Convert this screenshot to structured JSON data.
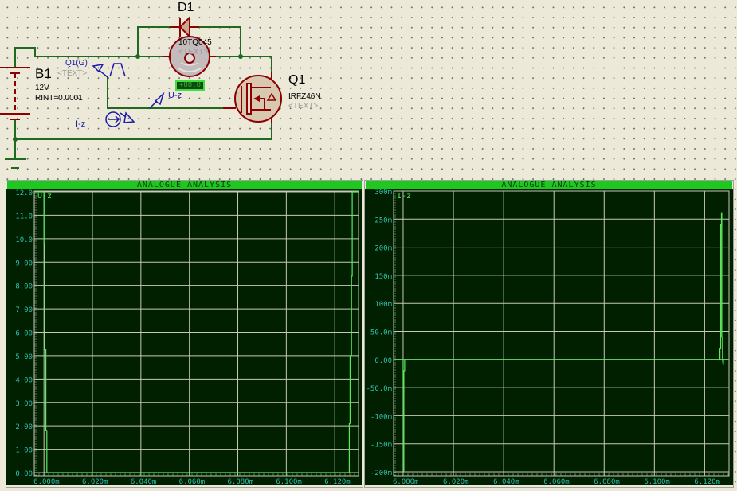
{
  "schematic": {
    "battery": {
      "ref": "B1",
      "text": "<TEXT>",
      "value": "12V",
      "rint": "RINT=0.0001"
    },
    "diode": {
      "ref": "D1",
      "part": "10TQ045"
    },
    "motor": {
      "text": "<TEXT>",
      "display": "+88.8"
    },
    "mosfet": {
      "ref": "Q1",
      "part": "IRFZ46N",
      "text": "<TEXT>"
    },
    "generator": {
      "label": "Q1(G)",
      "text": "<TEXT>"
    },
    "voltage_probe": {
      "label": "U-z"
    },
    "current_probe": {
      "label": "I-z"
    },
    "colors": {
      "wire": "#1f6a1f",
      "component": "#8b0000",
      "probe": "#1a1aa8"
    }
  },
  "chart_data": [
    {
      "type": "line",
      "title": "ANALOGUE ANALYSIS",
      "xlabel": "",
      "ylabel": "",
      "grid": true,
      "xlim": [
        5.996,
        6.1298
      ],
      "ylim": [
        0,
        12
      ],
      "xticks": [
        "6.000m",
        "6.020m",
        "6.040m",
        "6.060m",
        "6.080m",
        "6.100m",
        "6.120m"
      ],
      "xtick_values": [
        6.0,
        6.02,
        6.04,
        6.06,
        6.08,
        6.1,
        6.12
      ],
      "yticks": [
        "0.00",
        "1.00",
        "2.00",
        "3.00",
        "4.00",
        "5.00",
        "6.00",
        "7.00",
        "8.00",
        "9.00",
        "10.0",
        "11.0",
        "12.0"
      ],
      "ytick_values": [
        0,
        1,
        2,
        3,
        4,
        5,
        6,
        7,
        8,
        9,
        10,
        11,
        12
      ],
      "series": [
        {
          "name": "U-z",
          "color": "#5ee65e",
          "points": [
            [
              5.996,
              12
            ],
            [
              6.0,
              12
            ],
            [
              6.0,
              9.8
            ],
            [
              6.0003,
              9.8
            ],
            [
              6.0003,
              5.25
            ],
            [
              6.0008,
              5.25
            ],
            [
              6.0008,
              1.8
            ],
            [
              6.0012,
              1.8
            ],
            [
              6.0012,
              0
            ],
            [
              6.126,
              0
            ],
            [
              6.126,
              2.1
            ],
            [
              6.1263,
              2.1
            ],
            [
              6.1263,
              5.0
            ],
            [
              6.1269,
              5.0
            ],
            [
              6.1269,
              8.4
            ],
            [
              6.1272,
              8.4
            ],
            [
              6.1272,
              12
            ],
            [
              6.1298,
              12
            ]
          ]
        }
      ]
    },
    {
      "type": "line",
      "title": "ANALOGUE ANALYSIS",
      "xlabel": "",
      "ylabel": "",
      "grid": true,
      "xlim": [
        5.9962,
        6.1297
      ],
      "ylim": [
        -200,
        300
      ],
      "xticks": [
        "6.000m",
        "6.020m",
        "6.040m",
        "6.060m",
        "6.080m",
        "6.100m",
        "6.120m"
      ],
      "xtick_values": [
        6.0,
        6.02,
        6.04,
        6.06,
        6.08,
        6.1,
        6.12
      ],
      "yticks": [
        "-200m",
        "-150m",
        "-100m",
        "-50.0m",
        "0.00",
        "50.0m",
        "100m",
        "150m",
        "200m",
        "250m",
        "300m"
      ],
      "ytick_values": [
        -200,
        -150,
        -100,
        -50,
        0,
        50,
        100,
        150,
        200,
        250,
        300
      ],
      "series": [
        {
          "name": "I-z",
          "color": "#5ee65e",
          "points": [
            [
              5.9962,
              0
            ],
            [
              6.0,
              0
            ],
            [
              6.0,
              -40
            ],
            [
              6.00016,
              -40
            ],
            [
              6.00016,
              -200
            ],
            [
              6.0003,
              -200
            ],
            [
              6.0003,
              -20
            ],
            [
              6.0006,
              -20
            ],
            [
              6.0006,
              0
            ],
            [
              6.1261,
              0
            ],
            [
              6.1261,
              20
            ],
            [
              6.1264,
              20
            ],
            [
              6.1264,
              240
            ],
            [
              6.1267,
              240
            ],
            [
              6.1267,
              260
            ],
            [
              6.1268,
              260
            ],
            [
              6.1268,
              40
            ],
            [
              6.1271,
              40
            ],
            [
              6.1271,
              0
            ],
            [
              6.1274,
              -10
            ],
            [
              6.1275,
              0
            ],
            [
              6.1297,
              0
            ]
          ]
        }
      ]
    }
  ]
}
